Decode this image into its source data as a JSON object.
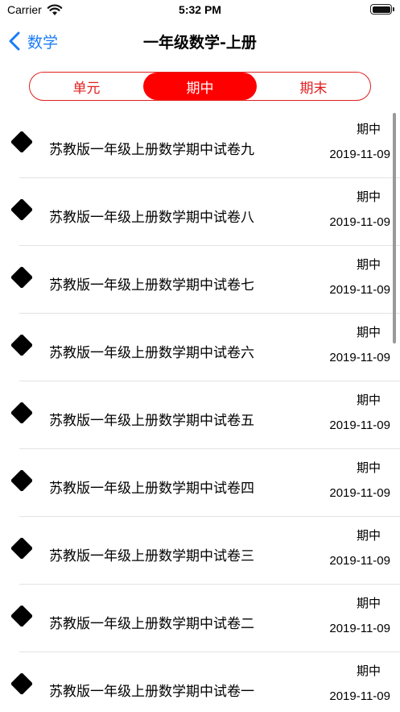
{
  "status_bar": {
    "carrier": "Carrier",
    "time": "5:32 PM"
  },
  "nav": {
    "back_label": "数学",
    "title": "一年级数学-上册"
  },
  "segments": [
    {
      "label": "单元",
      "active": false
    },
    {
      "label": "期中",
      "active": true
    },
    {
      "label": "期末",
      "active": false
    }
  ],
  "colors": {
    "accent_red": "#ff0000",
    "nav_blue": "#1a7cf5"
  },
  "items": [
    {
      "title": "苏教版一年级上册数学期中试卷九",
      "tag": "期中",
      "date": "2019-11-09"
    },
    {
      "title": "苏教版一年级上册数学期中试卷八",
      "tag": "期中",
      "date": "2019-11-09"
    },
    {
      "title": "苏教版一年级上册数学期中试卷七",
      "tag": "期中",
      "date": "2019-11-09"
    },
    {
      "title": "苏教版一年级上册数学期中试卷六",
      "tag": "期中",
      "date": "2019-11-09"
    },
    {
      "title": "苏教版一年级上册数学期中试卷五",
      "tag": "期中",
      "date": "2019-11-09"
    },
    {
      "title": "苏教版一年级上册数学期中试卷四",
      "tag": "期中",
      "date": "2019-11-09"
    },
    {
      "title": "苏教版一年级上册数学期中试卷三",
      "tag": "期中",
      "date": "2019-11-09"
    },
    {
      "title": "苏教版一年级上册数学期中试卷二",
      "tag": "期中",
      "date": "2019-11-09"
    },
    {
      "title": "苏教版一年级上册数学期中试卷一",
      "tag": "期中",
      "date": "2019-11-09"
    }
  ]
}
